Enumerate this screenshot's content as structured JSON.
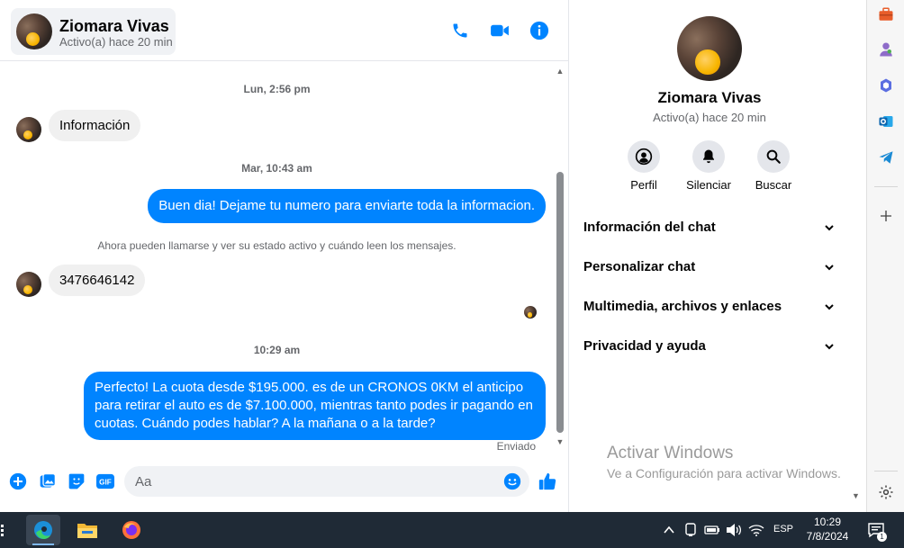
{
  "contact": {
    "name": "Ziomara Vivas",
    "status": "Activo(a) hace 20 min"
  },
  "header_actions": [
    "phone-icon",
    "video-call-icon",
    "info-icon"
  ],
  "colors": {
    "accent": "#0084ff",
    "incoming_bubble": "#f0f0f0",
    "muted_text": "#65676b",
    "taskbar": "#1f2a36"
  },
  "conversation": {
    "ts1": "Lun, 2:56 pm",
    "msg1": "Información",
    "ts2": "Mar, 10:43 am",
    "msg2": "Buen dia! Dejame tu numero para enviarte toda la informacion.",
    "note": "Ahora pueden llamarse y ver su estado activo y cuándo leen los mensajes.",
    "msg3": "3476646142",
    "ts3": "10:29 am",
    "msg4_line1": "Perfecto! La cuota desde $195.000. es de un CRONOS 0KM el anticipo",
    "msg4_line2": "para retirar el auto es de $7.100.000, mientras tanto podes ir pagando en",
    "msg4_line3": "cuotas. Cuándo podes hablar? A la mañana o a la tarde?",
    "sent_status": "Enviado"
  },
  "composer": {
    "placeholder": "Aa",
    "icons": [
      "plus-icon",
      "image-icon",
      "sticker-icon",
      "gif-icon",
      "emoji-icon",
      "like-icon"
    ],
    "gif_label": "GIF"
  },
  "info_panel": {
    "name": "Ziomara Vivas",
    "status": "Activo(a) hace 20 min",
    "actions": [
      {
        "label": "Perfil",
        "icon": "profile-icon"
      },
      {
        "label": "Silenciar",
        "icon": "bell-icon"
      },
      {
        "label": "Buscar",
        "icon": "search-icon"
      }
    ],
    "sections": [
      "Información del chat",
      "Personalizar chat",
      "Multimedia, archivos y enlaces",
      "Privacidad y ayuda"
    ]
  },
  "watermark": {
    "title": "Activar Windows",
    "subtitle": "Ve a Configuración para activar Windows."
  },
  "edge_sidebar": [
    "briefcase-icon",
    "games-icon",
    "copilot-icon",
    "outlook-icon",
    "telegram-icon",
    "add-icon",
    "settings-icon"
  ],
  "taskbar": {
    "apps": [
      "edge-icon",
      "file-explorer-icon",
      "firefox-icon"
    ],
    "language": "ESP",
    "time": "10:29",
    "date": "7/8/2024",
    "notification_count": "1"
  }
}
